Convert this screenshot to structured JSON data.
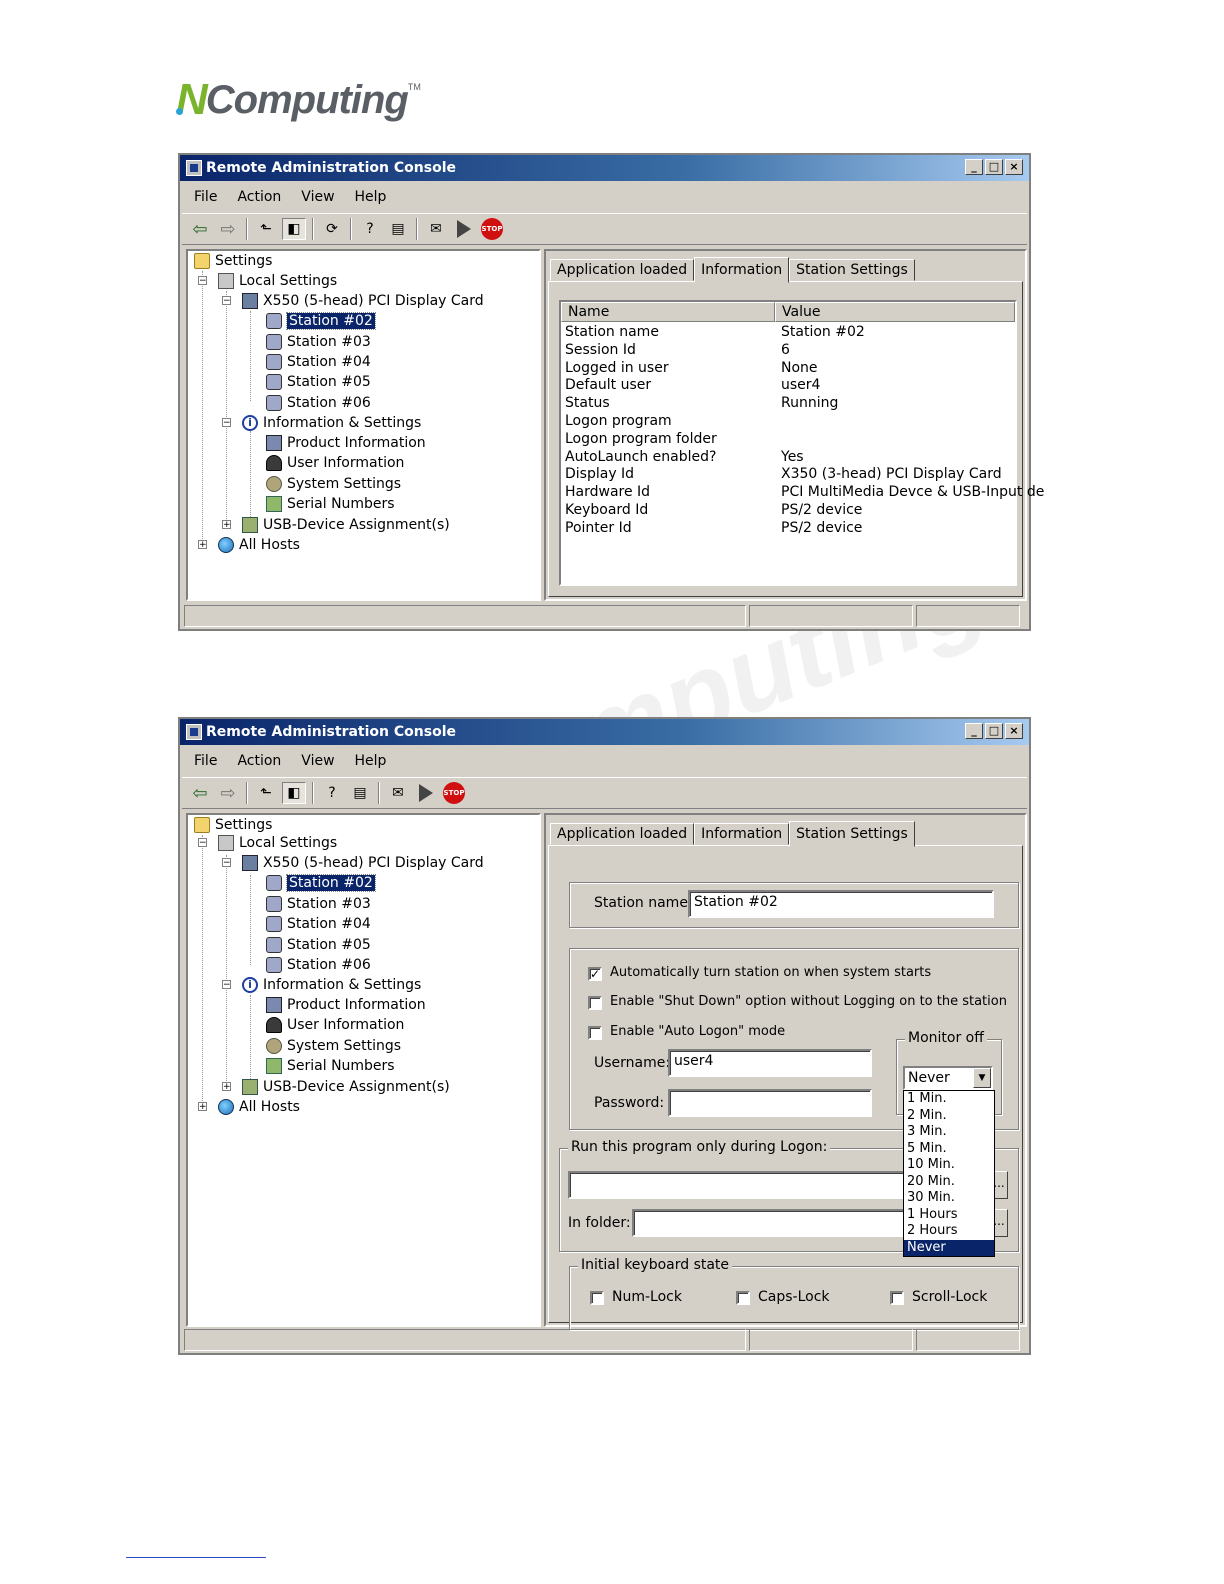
{
  "logo": {
    "text_n": "N",
    "text_rest": "Computing",
    "tm": "TM"
  },
  "window1": {
    "title": "Remote Administration Console",
    "menu": [
      "File",
      "Action",
      "View",
      "Help"
    ],
    "tree": {
      "settings": "Settings",
      "local_settings": "Local Settings",
      "card": "X550 (5-head)  PCI Display Card",
      "stations": [
        "Station #02",
        "Station #03",
        "Station #04",
        "Station #05",
        "Station #06"
      ],
      "info_settings": "Information & Settings",
      "info_items": [
        "Product Information",
        "User Information",
        "System Settings",
        "Serial Numbers"
      ],
      "usb": "USB-Device Assignment(s)",
      "all_hosts": "All Hosts"
    },
    "tabs": [
      "Application loaded",
      "Information",
      "Station Settings"
    ],
    "active_tab": "Information",
    "list": {
      "headers": [
        "Name",
        "Value"
      ],
      "rows": [
        [
          "Station name",
          "Station #02"
        ],
        [
          "Session Id",
          "6"
        ],
        [
          "Logged in user",
          "None"
        ],
        [
          "Default user",
          "user4"
        ],
        [
          "Status",
          "Running"
        ],
        [
          "Logon program",
          ""
        ],
        [
          "Logon program folder",
          ""
        ],
        [
          "AutoLaunch enabled?",
          "Yes"
        ],
        [
          "Display Id",
          "X350 (3-head)  PCI Display Card"
        ],
        [
          "Hardware Id",
          "PCI MultiMedia Devce & USB-Input de"
        ],
        [
          "Keyboard Id",
          "PS/2 device"
        ],
        [
          "Pointer Id",
          "PS/2 device"
        ]
      ]
    }
  },
  "window2": {
    "title": "Remote Administration Console",
    "menu": [
      "File",
      "Action",
      "View",
      "Help"
    ],
    "tree": {
      "settings": "Settings",
      "local_settings": "Local Settings",
      "card": "X550 (5-head)  PCI Display Card",
      "stations": [
        "Station #02",
        "Station #03",
        "Station #04",
        "Station #05",
        "Station #06"
      ],
      "info_settings": "Information & Settings",
      "info_items": [
        "Product Information",
        "User Information",
        "System Settings",
        "Serial Numbers"
      ],
      "usb": "USB-Device Assignment(s)",
      "all_hosts": "All Hosts"
    },
    "tabs": [
      "Application loaded",
      "Information",
      "Station Settings"
    ],
    "active_tab": "Station Settings",
    "station_settings": {
      "station_name_label": "Station name:",
      "station_name_value": "Station #02",
      "auto_turn_on_label": "Automatically turn station on when system starts",
      "auto_turn_on_checked": true,
      "shutdown_label": "Enable \"Shut Down\" option without Logging on to the station",
      "shutdown_checked": false,
      "auto_logon_label": "Enable \"Auto Logon\" mode",
      "auto_logon_checked": false,
      "username_label": "Username:",
      "username_value": "user4",
      "password_label": "Password:",
      "password_value": "",
      "monitor_off_label": "Monitor off",
      "monitor_off_value": "Never",
      "monitor_off_options": [
        "1 Min.",
        "2 Min.",
        "3 Min.",
        "5 Min.",
        "10 Min.",
        "20 Min.",
        "30 Min.",
        "1 Hours",
        "2 Hours",
        "Never"
      ],
      "run_program_label": "Run this program only during Logon:",
      "run_program_value": "",
      "browse_label": "...",
      "in_folder_label": "In folder:",
      "in_folder_value": "",
      "keyboard_label": "Initial keyboard state",
      "num_lock_label": "Num-Lock",
      "caps_lock_label": "Caps-Lock",
      "scroll_lock_label": "Scroll-Lock"
    }
  },
  "toolbar": {
    "stop_label": "STOP"
  },
  "watermark": "mputing"
}
